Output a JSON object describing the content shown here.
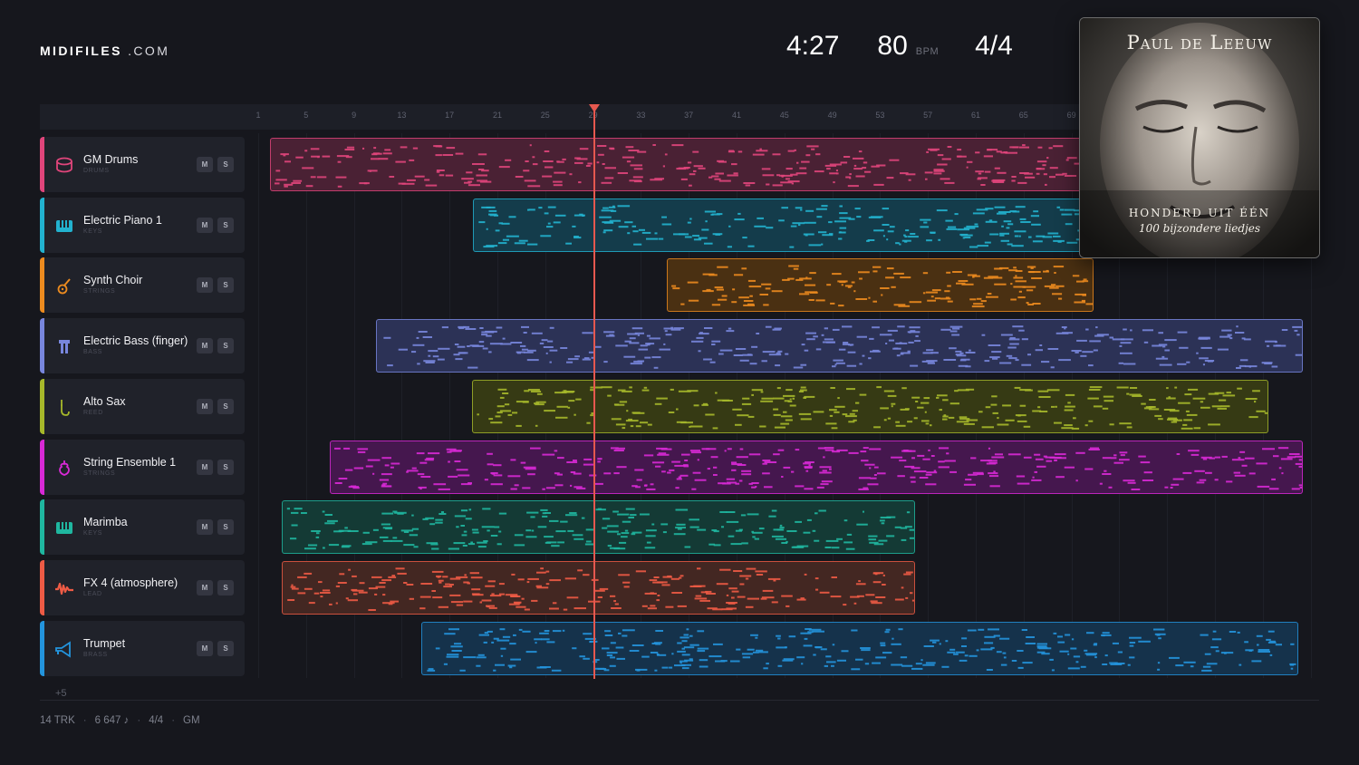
{
  "brand": {
    "name_bold": "MIDIFILES",
    "name_suffix": ".COM"
  },
  "transport": {
    "duration": "4:27",
    "tempo": "80",
    "tempo_unit": "BPM",
    "time_signature": "4/4"
  },
  "album": {
    "artist": "Paul de Leeuw",
    "title": "HONDERD UIT ÉÉN",
    "subtitle": "100 bijzondere liedjes"
  },
  "ruler": {
    "bars": [
      "1",
      "5",
      "9",
      "13",
      "17",
      "21",
      "25",
      "29",
      "33",
      "37",
      "41",
      "45",
      "49",
      "53",
      "57",
      "61",
      "65",
      "69"
    ]
  },
  "playhead": {
    "bar": 29
  },
  "tracks": [
    {
      "name": "GM Drums",
      "category": "DRUMS",
      "color": "#e0457b",
      "clip_bg": "#4a2134",
      "icon": "drum-icon",
      "mute": "M",
      "solo": "S",
      "clip_start_bar": 1.5,
      "clip_end_bar": 70
    },
    {
      "name": "Electric Piano 1",
      "category": "KEYS",
      "color": "#22b2cf",
      "clip_bg": "#143c4b",
      "icon": "piano-icon",
      "mute": "M",
      "solo": "S",
      "clip_start_bar": 18.5,
      "clip_end_bar": 70
    },
    {
      "name": "Synth Choir",
      "category": "STRINGS",
      "color": "#ec8b1f",
      "clip_bg": "#4a3012",
      "icon": "guitar-icon",
      "mute": "M",
      "solo": "S",
      "clip_start_bar": 34.7,
      "clip_end_bar": 70.4
    },
    {
      "name": "Electric Bass (finger)",
      "category": "BASS",
      "color": "#7886dd",
      "clip_bg": "#2c3256",
      "icon": "bass-icon",
      "mute": "M",
      "solo": "S",
      "clip_start_bar": 10.4,
      "clip_end_bar": 88
    },
    {
      "name": "Alto Sax",
      "category": "REED",
      "color": "#a6b82a",
      "clip_bg": "#363a14",
      "icon": "sax-icon",
      "mute": "M",
      "solo": "S",
      "clip_start_bar": 18.4,
      "clip_end_bar": 85
    },
    {
      "name": "String Ensemble 1",
      "category": "STRINGS",
      "color": "#d829d6",
      "clip_bg": "#45174e",
      "icon": "violin-icon",
      "mute": "M",
      "solo": "S",
      "clip_start_bar": 6.5,
      "clip_end_bar": 88
    },
    {
      "name": "Marimba",
      "category": "KEYS",
      "color": "#1fb7a0",
      "clip_bg": "#143a35",
      "icon": "marimba-icon",
      "mute": "M",
      "solo": "S",
      "clip_start_bar": 2.5,
      "clip_end_bar": 55.5
    },
    {
      "name": "FX 4 (atmosphere)",
      "category": "LEAD",
      "color": "#ee5b45",
      "clip_bg": "#432722",
      "icon": "wave-icon",
      "mute": "M",
      "solo": "S",
      "clip_start_bar": 2.5,
      "clip_end_bar": 55.5
    },
    {
      "name": "Trumpet",
      "category": "BRASS",
      "color": "#2394dd",
      "clip_bg": "#15324b",
      "icon": "trumpet-icon",
      "mute": "M",
      "solo": "S",
      "clip_start_bar": 14.2,
      "clip_end_bar": 87.5
    }
  ],
  "more_tracks": "+5",
  "status": {
    "tracks": "14 TRK",
    "notes": "6 647 ♪",
    "meter": "4/4",
    "standard": "GM"
  }
}
